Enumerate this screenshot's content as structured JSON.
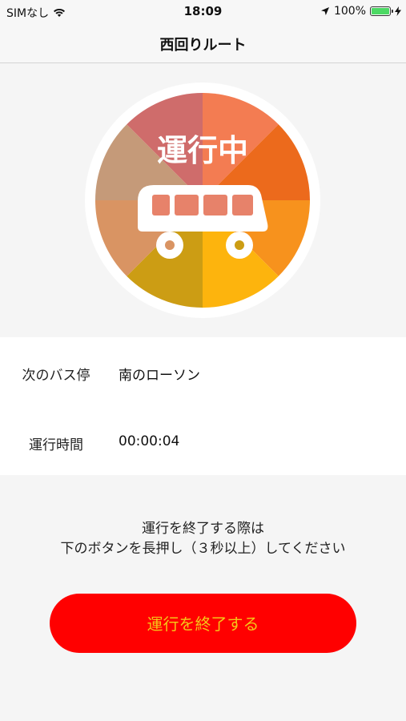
{
  "status_bar": {
    "carrier": "SIMなし",
    "time": "18:09",
    "battery_percent": "100%"
  },
  "nav": {
    "title": "西回りルート"
  },
  "status_circle": {
    "label": "運行中",
    "icon": "bus-icon",
    "segment_colors": [
      "#f37c52",
      "#ec6a1c",
      "#f7921d",
      "#fdb40d",
      "#cc9d14",
      "#d99463",
      "#c59a79",
      "#cf6c6b"
    ]
  },
  "info": {
    "next_stop_label": "次のバス停",
    "next_stop_value": "南のローソン",
    "run_time_label": "運行時間",
    "run_time_value": "00:00:04"
  },
  "instruction": {
    "line1": "運行を終了する際は",
    "line2": "下のボタンを長押し（３秒以上）してください"
  },
  "end_button": {
    "label": "運行を終了する",
    "background": "#ff0000",
    "text_color": "#f5c518"
  }
}
